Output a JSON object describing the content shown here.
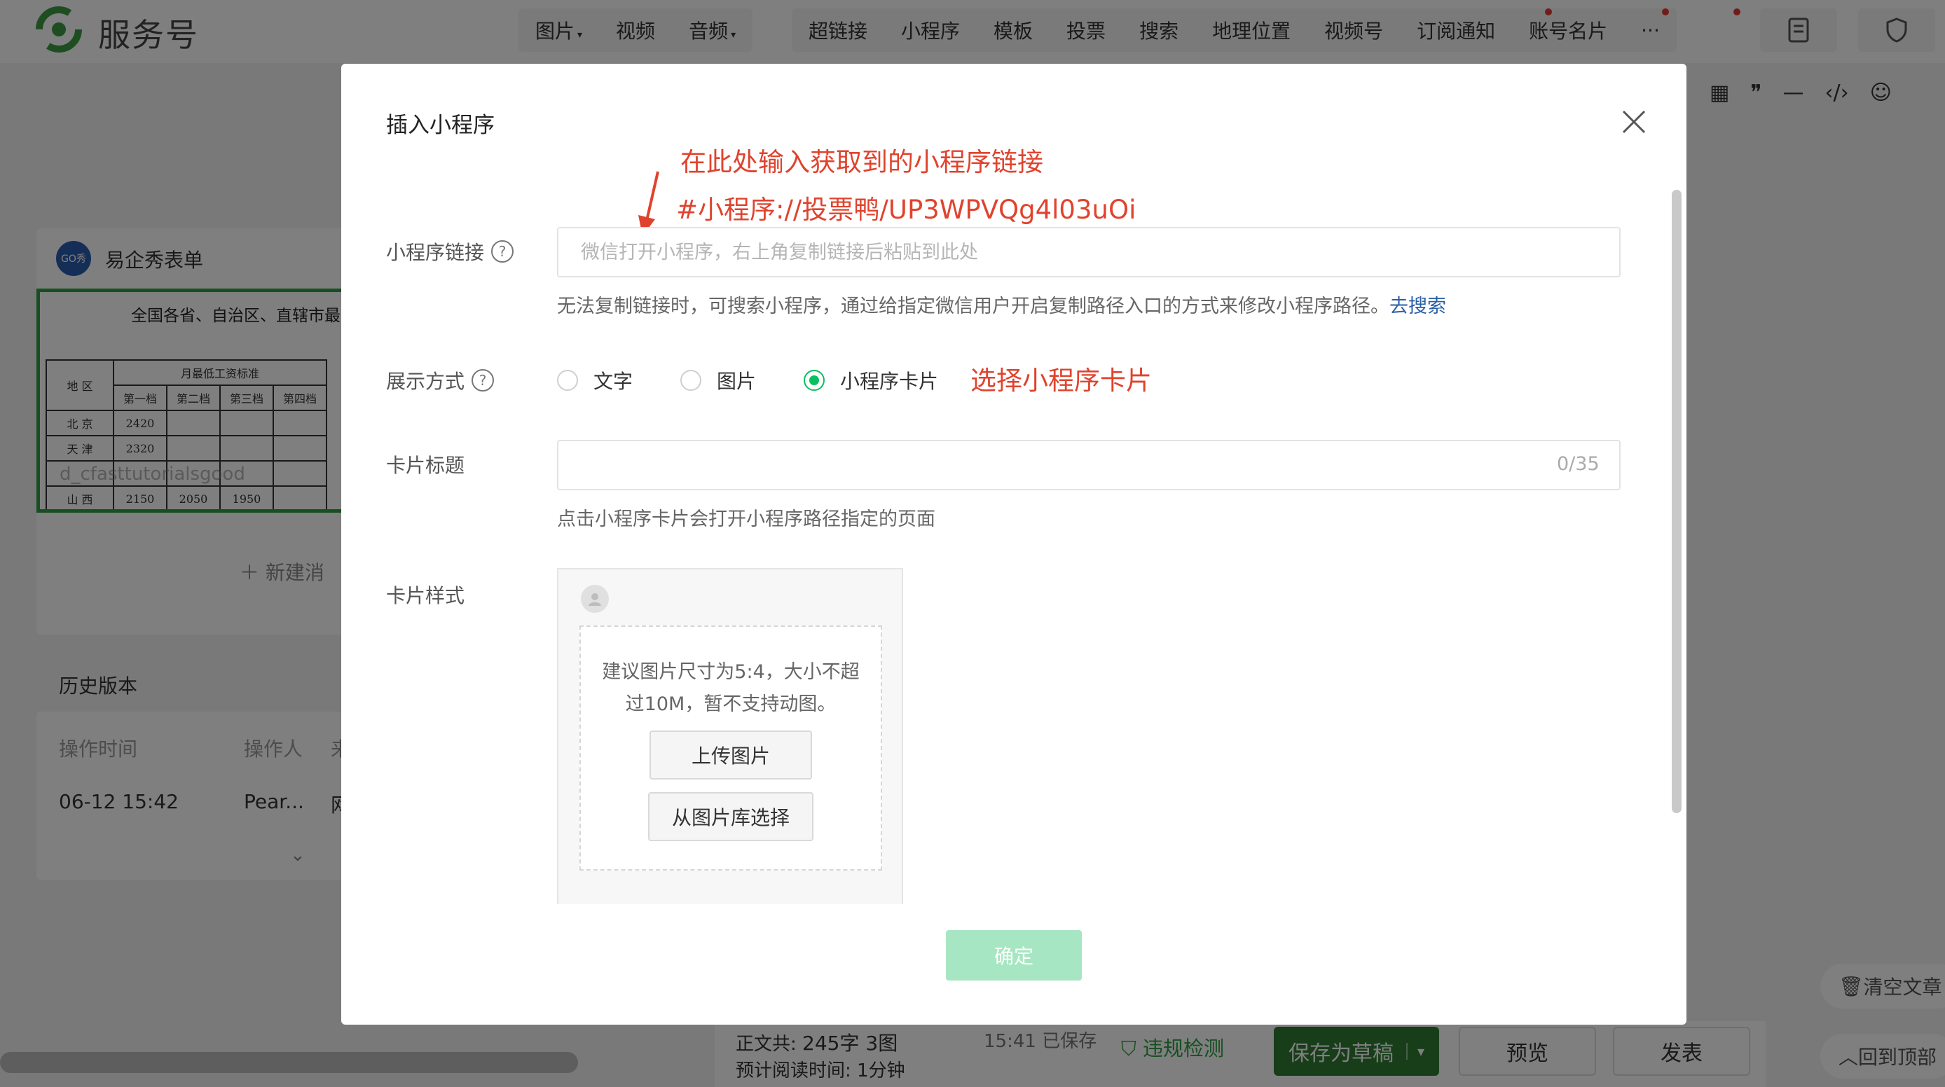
{
  "app": {
    "brand": "服务号"
  },
  "toolbar": {
    "media_items": [
      {
        "label": "图片",
        "has_caret": true
      },
      {
        "label": "视频",
        "has_caret": false
      },
      {
        "label": "音频",
        "has_caret": true
      }
    ],
    "insert_items": [
      "超链接",
      "小程序",
      "模板",
      "投票",
      "搜索",
      "地理位置",
      "视频号",
      "订阅通知",
      "账号名片"
    ],
    "more": "···"
  },
  "left_panel": {
    "account_name": "易企秀表单",
    "account_logo_text": "GO秀",
    "doc_title": "全国各省、自治区、直辖市最",
    "table": {
      "region_header": "地 区",
      "group_header": "月最低工资标准",
      "tiers": [
        "第一档",
        "第二档",
        "第三档",
        "第四档"
      ],
      "rows": [
        {
          "region": "北 京",
          "values": [
            "2420",
            "",
            "",
            ""
          ]
        },
        {
          "region": "天 津",
          "values": [
            "2320",
            "",
            "",
            ""
          ]
        },
        {
          "region": "",
          "values": [
            "",
            "",
            "",
            ""
          ]
        },
        {
          "region": "山 西",
          "values": [
            "2150",
            "2050",
            "1950",
            ""
          ]
        }
      ]
    },
    "watermark": "d_cfasttutorialsgood",
    "new_button": "新建消",
    "history_title": "历史版本",
    "history_cols": [
      "操作时间",
      "操作人",
      "来"
    ],
    "history_row": {
      "time": "06-12 15:42",
      "operator": "Pear...",
      "extra": "网"
    }
  },
  "bottom": {
    "word_count_label": "正文共:",
    "word_count_value": "245字 3图",
    "read_time_label": "预计阅读时间:",
    "read_time_value": "1分钟",
    "saved_time": "15:41",
    "saved_status": "已保存",
    "violation_check": "违规检测",
    "save_draft": "保存为草稿",
    "preview": "预览",
    "publish": "发表"
  },
  "side": {
    "clear": "清空文章",
    "back_top": "回到顶部"
  },
  "modal": {
    "title": "插入小程序",
    "annotation_1": "在此处输入获取到的小程序链接",
    "annotation_2": "#小程序://投票鸭/UP3WPVQg4l03uOi",
    "annotation_3": "选择小程序卡片",
    "link_label": "小程序链接",
    "link_placeholder": "微信打开小程序，右上角复制链接后粘贴到此处",
    "link_hint": "无法复制链接时，可搜索小程序，通过给指定微信用户开启复制路径入口的方式来修改小程序路径。",
    "link_hint_action": "去搜索",
    "display_label": "展示方式",
    "display_options": [
      "文字",
      "图片",
      "小程序卡片"
    ],
    "display_selected": "小程序卡片",
    "card_title_label": "卡片标题",
    "card_title_counter": "0/35",
    "card_title_hint": "点击小程序卡片会打开小程序路径指定的页面",
    "card_style_label": "卡片样式",
    "upload_tip_line1": "建议图片尺寸为5:4，大小不超",
    "upload_tip_line2": "过10M，暂不支持动图。",
    "upload_button": "上传图片",
    "library_button": "从图片库选择",
    "confirm": "确定"
  },
  "colors": {
    "accent_green": "#07c160",
    "disabled_green": "#a7e6c2",
    "annotation_red": "#e0432d",
    "dark_green_button": "#2e7d32",
    "link_blue": "#2b5fa6"
  }
}
